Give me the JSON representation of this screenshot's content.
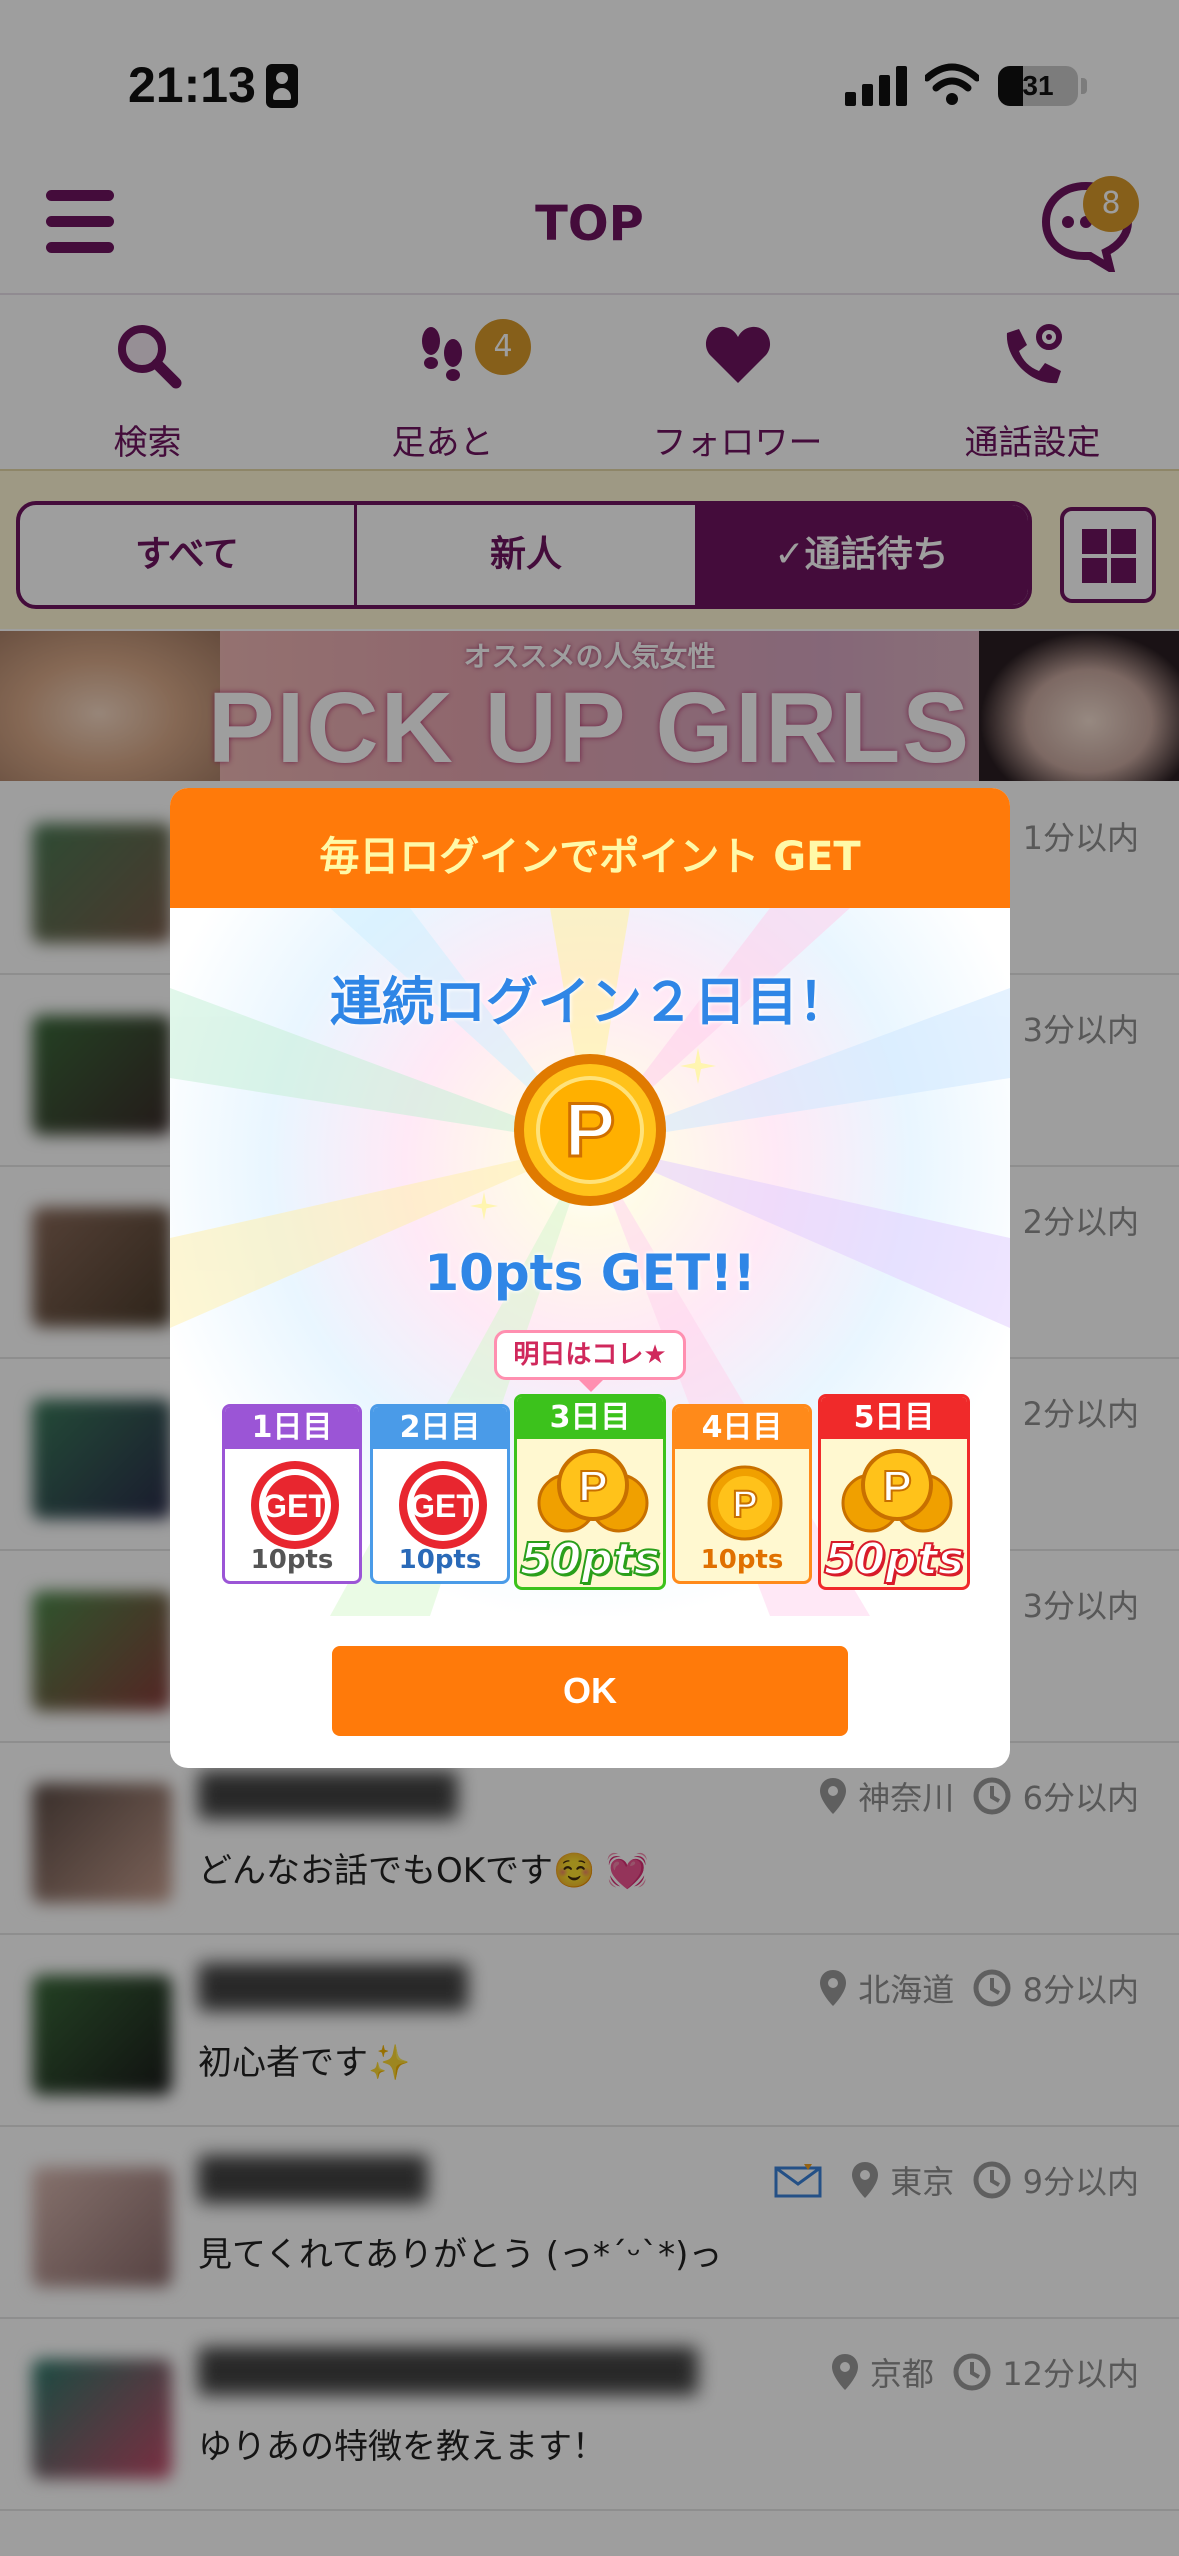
{
  "status_bar": {
    "time": "21:13",
    "battery": "31"
  },
  "header": {
    "title": "TOP",
    "chat_badge": "8"
  },
  "quick_nav": [
    {
      "label": "検索",
      "icon": "search-icon"
    },
    {
      "label": "足あと",
      "icon": "footprints-icon",
      "badge": "4"
    },
    {
      "label": "フォロワー",
      "icon": "heart-icon"
    },
    {
      "label": "通話設定",
      "icon": "phone-settings-icon"
    }
  ],
  "filter_tabs": [
    {
      "label": "すべて"
    },
    {
      "label": "新人"
    },
    {
      "label": "✓通話待ち",
      "active": true
    }
  ],
  "banner": {
    "subtitle": "オススメの人気女性",
    "title": "PICK UP GIRLS"
  },
  "users": [
    {
      "time": "1分以内",
      "location": "",
      "message": ""
    },
    {
      "time": "3分以内",
      "location": "",
      "message": ""
    },
    {
      "time": "2分以内",
      "location": "",
      "message": ""
    },
    {
      "time": "2分以内",
      "location": "",
      "message": ""
    },
    {
      "time": "3分以内",
      "location": "",
      "message": ""
    },
    {
      "time": "6分以内",
      "location": "神奈川",
      "message": "どんなお話でもOKです☺️ 💓"
    },
    {
      "time": "8分以内",
      "location": "北海道",
      "message": "初心者です✨"
    },
    {
      "time": "9分以内",
      "location": "東京",
      "message": "見てくれてありがとう (っ*´ᵕ`*)っ",
      "has_mail": true
    },
    {
      "time": "12分以内",
      "location": "京都",
      "message": "ゆりあの特徴を教えます！"
    }
  ],
  "modal": {
    "title": "毎日ログインでポイント GET",
    "headline": "連続ログイン２日目！",
    "coin_letter": "P",
    "earned": "10pts GET!!",
    "tomorrow_tag": "明日はコレ★",
    "days": [
      {
        "label": "1日目",
        "stamp": "GET",
        "points": "10pts",
        "color": "#9b55d6"
      },
      {
        "label": "2日目",
        "stamp": "GET",
        "points": "10pts",
        "color": "#4a9be8"
      },
      {
        "label": "3日目",
        "stamp": "P",
        "points": "50pts",
        "color": "#3cc21c"
      },
      {
        "label": "4日目",
        "stamp": "P",
        "points": "10pts",
        "color": "#ff8a1a"
      },
      {
        "label": "5日目",
        "stamp": "P",
        "points": "50pts",
        "color": "#f02a2a"
      }
    ],
    "ok_label": "OK"
  },
  "colors": {
    "brand": "#6e1460",
    "accent": "#ff7a0a",
    "badge": "#d99a2b"
  }
}
